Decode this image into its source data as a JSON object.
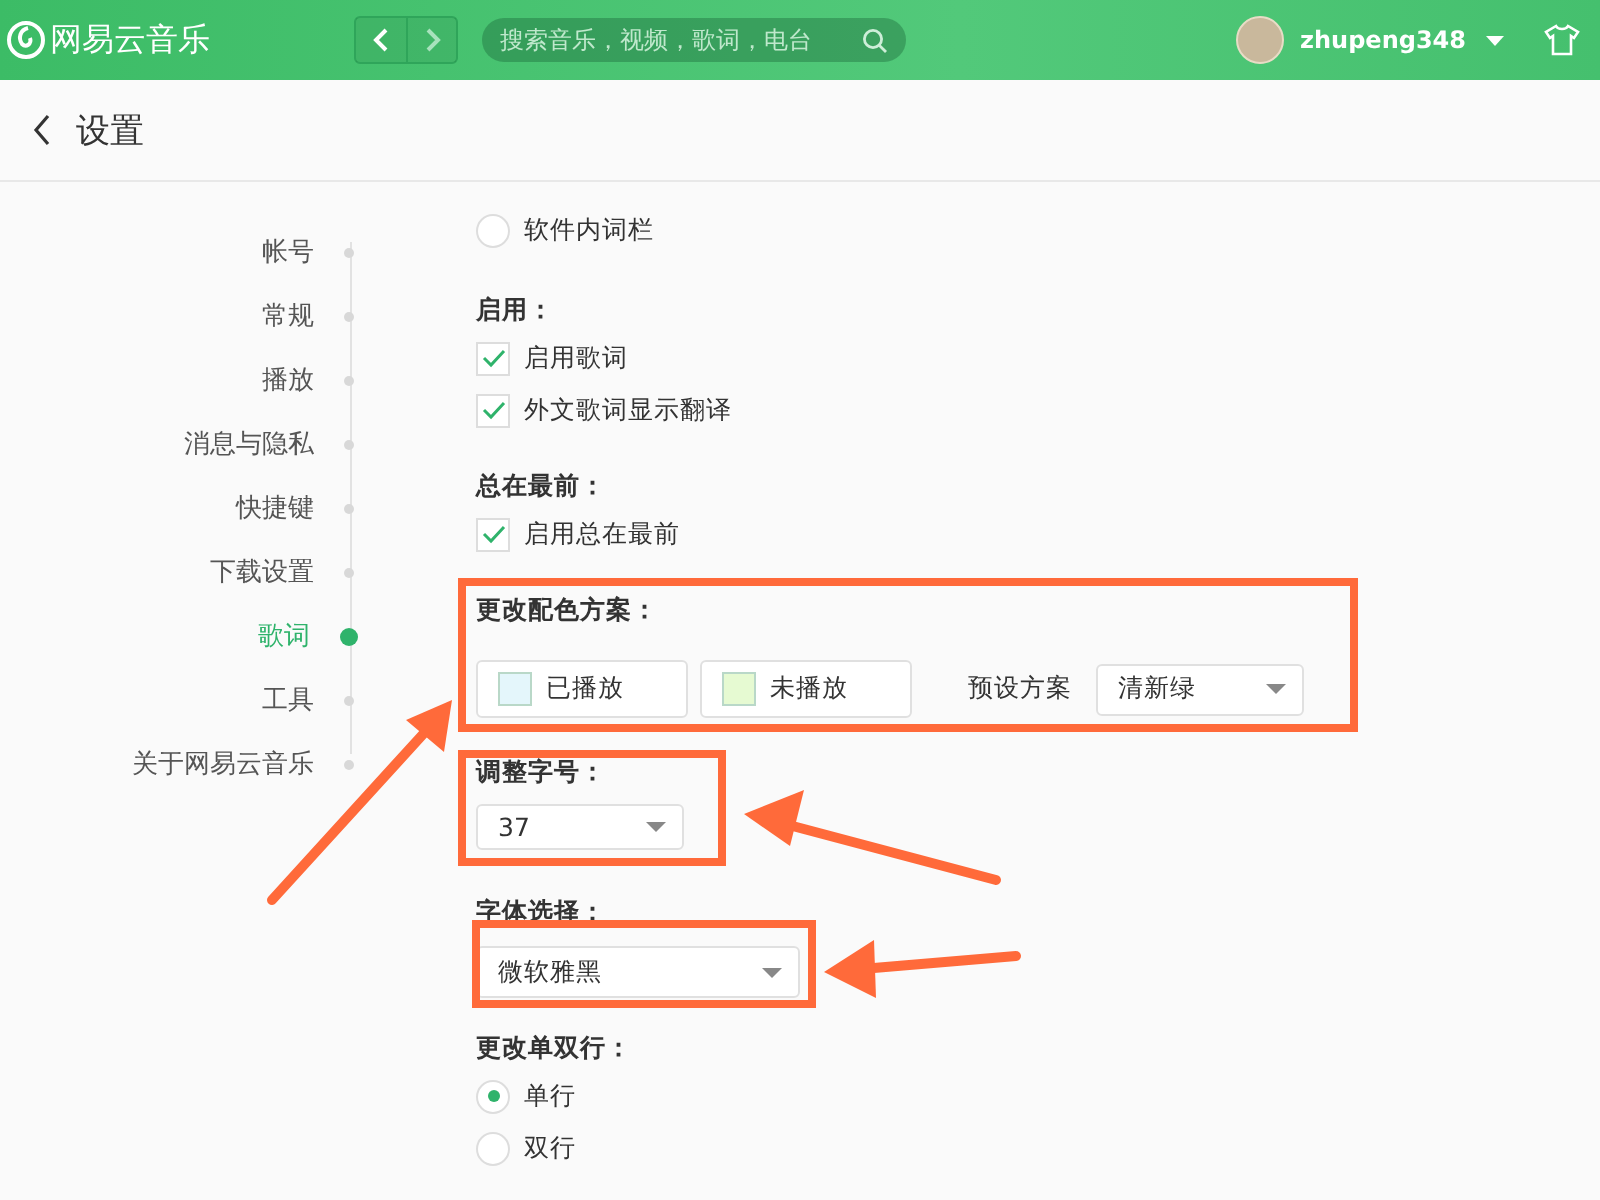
{
  "header": {
    "logo_text": "网易云音乐",
    "search": {
      "placeholder": "搜索音乐，视频，歌词，电台"
    },
    "username": "zhupeng348"
  },
  "page_title": "设置",
  "sidebar": {
    "items": [
      {
        "label": "帐号",
        "selected": false
      },
      {
        "label": "常规",
        "selected": false
      },
      {
        "label": "播放",
        "selected": false
      },
      {
        "label": "消息与隐私",
        "selected": false
      },
      {
        "label": "快捷键",
        "selected": false
      },
      {
        "label": "下载设置",
        "selected": false
      },
      {
        "label": "歌词",
        "selected": true
      },
      {
        "label": "工具",
        "selected": false
      },
      {
        "label": "关于网易云音乐",
        "selected": false
      }
    ]
  },
  "sections": [
    {
      "kind": "radio",
      "options": [
        {
          "label": "软件内词栏",
          "selected": false
        }
      ]
    },
    {
      "kind": "checkbox",
      "title": "启用：",
      "options": [
        {
          "label": "启用歌词",
          "checked": true
        },
        {
          "label": "外文歌词显示翻译",
          "checked": true
        }
      ]
    },
    {
      "kind": "checkbox",
      "title": "总在最前：",
      "options": [
        {
          "label": "启用总在最前",
          "checked": true
        }
      ]
    },
    {
      "kind": "colors",
      "title": "更改配色方案：",
      "swatches": [
        {
          "label": "已播放",
          "color": "#e4f6fb"
        },
        {
          "label": "未播放",
          "color": "#e6fad2"
        }
      ],
      "preset_label": "预设方案",
      "preset_value": "清新绿"
    },
    {
      "kind": "select",
      "title": "调整字号：",
      "value": "37"
    },
    {
      "kind": "wide-select",
      "title": "字体选择：",
      "value": "微软雅黑"
    },
    {
      "kind": "radio",
      "title": "更改单双行：",
      "options": [
        {
          "label": "单行",
          "selected": true
        },
        {
          "label": "双行",
          "selected": false
        }
      ]
    }
  ]
}
